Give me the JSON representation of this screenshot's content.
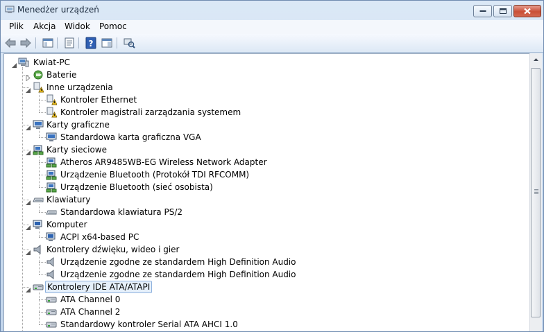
{
  "window": {
    "title": "Menedżer urządzeń"
  },
  "menu": [
    "Plik",
    "Akcja",
    "Widok",
    "Pomoc"
  ],
  "toolbar": {
    "buttons": [
      "back-icon",
      "forward-icon",
      "console-tree-icon",
      "properties-icon",
      "help-icon",
      "action-pane-icon",
      "scan-hardware-icon"
    ]
  },
  "tree": {
    "root": "Kwiat-PC",
    "categories": [
      {
        "label": "Baterie",
        "expanded": false,
        "children": []
      },
      {
        "label": "Inne urządzenia",
        "expanded": true,
        "children": [
          "Kontroler Ethernet",
          "Kontroler magistrali zarządzania systemem"
        ]
      },
      {
        "label": "Karty graficzne",
        "expanded": true,
        "children": [
          "Standardowa karta graficzna VGA"
        ]
      },
      {
        "label": "Karty sieciowe",
        "expanded": true,
        "children": [
          "Atheros AR9485WB-EG Wireless Network Adapter",
          "Urządzenie Bluetooth (Protokół TDI RFCOMM)",
          "Urządzenie Bluetooth (sieć osobista)"
        ]
      },
      {
        "label": "Klawiatury",
        "expanded": true,
        "children": [
          "Standardowa klawiatura PS/2"
        ]
      },
      {
        "label": "Komputer",
        "expanded": true,
        "children": [
          "ACPI x64-based PC"
        ]
      },
      {
        "label": "Kontrolery dźwięku, wideo i gier",
        "expanded": true,
        "children": [
          "Urządzenie zgodne ze standardem High Definition Audio",
          "Urządzenie zgodne ze standardem High Definition Audio"
        ]
      },
      {
        "label": "Kontrolery IDE ATA/ATAPI",
        "expanded": true,
        "selected": true,
        "children": [
          "ATA Channel 0",
          "ATA Channel 2",
          "Standardowy kontroler Serial ATA AHCI 1.0"
        ]
      }
    ]
  }
}
